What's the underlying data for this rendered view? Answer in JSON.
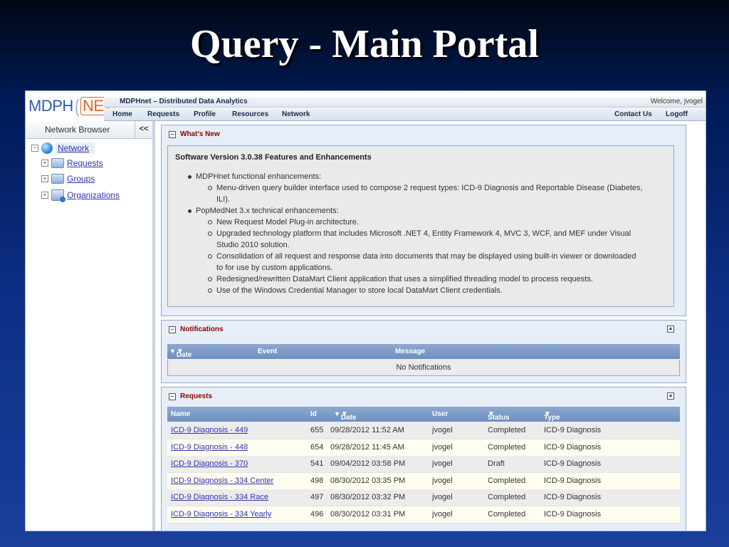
{
  "slide": {
    "title": "Query - Main Portal"
  },
  "app": {
    "logo_left": "MDPH",
    "logo_right": "NET",
    "app_title": "MDPHnet – Distributed Data Analytics",
    "welcome": "Welcome, jvogel",
    "nav": [
      "Home",
      "Requests",
      "Profile",
      "Resources",
      "Network"
    ],
    "contact": "Contact Us",
    "logoff": "Logoff"
  },
  "sidebar": {
    "title": "Network Browser",
    "collapse": "<<",
    "root": "Network",
    "items": [
      "Requests",
      "Groups",
      "Organizations"
    ]
  },
  "whats_new": {
    "title": "What's New",
    "heading": "Software Version 3.0.38 Features and Enhancements",
    "lines": [
      "MDPHnet functional enhancements:",
      "Menu-driven query builder interface used to compose 2 request types: ICD-9 Diagnosis and Reportable Disease (Diabetes,",
      "ILI).",
      "PopMedNet 3.x technical enhancements:",
      "New Request Model Plug-in architecture.",
      "Upgraded technology platform that includes Microsoft .NET 4, Entity Framework 4, MVC 3, WCF, and MEF under Visual",
      "Studio 2010 solution.",
      "Consolidation of all request and response data into documents that may be displayed using built-in viewer or downloaded",
      "to for use by custom applications.",
      "Redesigned/rewritten DataMart Client application that uses a simplified threading model to process requests.",
      "Use of the Windows Credential Manager to store local DataMart Client credentials."
    ]
  },
  "notifications": {
    "title": "Notifications",
    "columns": [
      "Date",
      "Event",
      "Message"
    ],
    "empty": "No Notifications"
  },
  "requests": {
    "title": "Requests",
    "columns": [
      "Name",
      "Id",
      "Date",
      "User",
      "Status",
      "Type"
    ],
    "rows": [
      [
        "ICD-9 Diagnosis - 449",
        "655",
        "09/28/2012 11:52 AM",
        "jvogel",
        "Completed",
        "ICD-9 Diagnosis"
      ],
      [
        "ICD-9 Diagnosis - 448",
        "654",
        "09/28/2012 11:45 AM",
        "jvogel",
        "Completed",
        "ICD-9 Diagnosis"
      ],
      [
        "ICD-9 Diagnosis - 370",
        "541",
        "09/04/2012 03:58 PM",
        "jvogel",
        "Draft",
        "ICD-9 Diagnosis"
      ],
      [
        "ICD-9 Diagnosis - 334 Center",
        "498",
        "08/30/2012 03:35 PM",
        "jvogel",
        "Completed",
        "ICD-9 Diagnosis"
      ],
      [
        "ICD-9 Diagnosis - 334 Race",
        "497",
        "08/30/2012 03:32 PM",
        "jvogel",
        "Completed",
        "ICD-9 Diagnosis"
      ],
      [
        "ICD-9 Diagnosis - 334 Yearly",
        "496",
        "08/30/2012 03:31 PM",
        "jvogel",
        "Completed",
        "ICD-9 Diagnosis"
      ]
    ]
  }
}
